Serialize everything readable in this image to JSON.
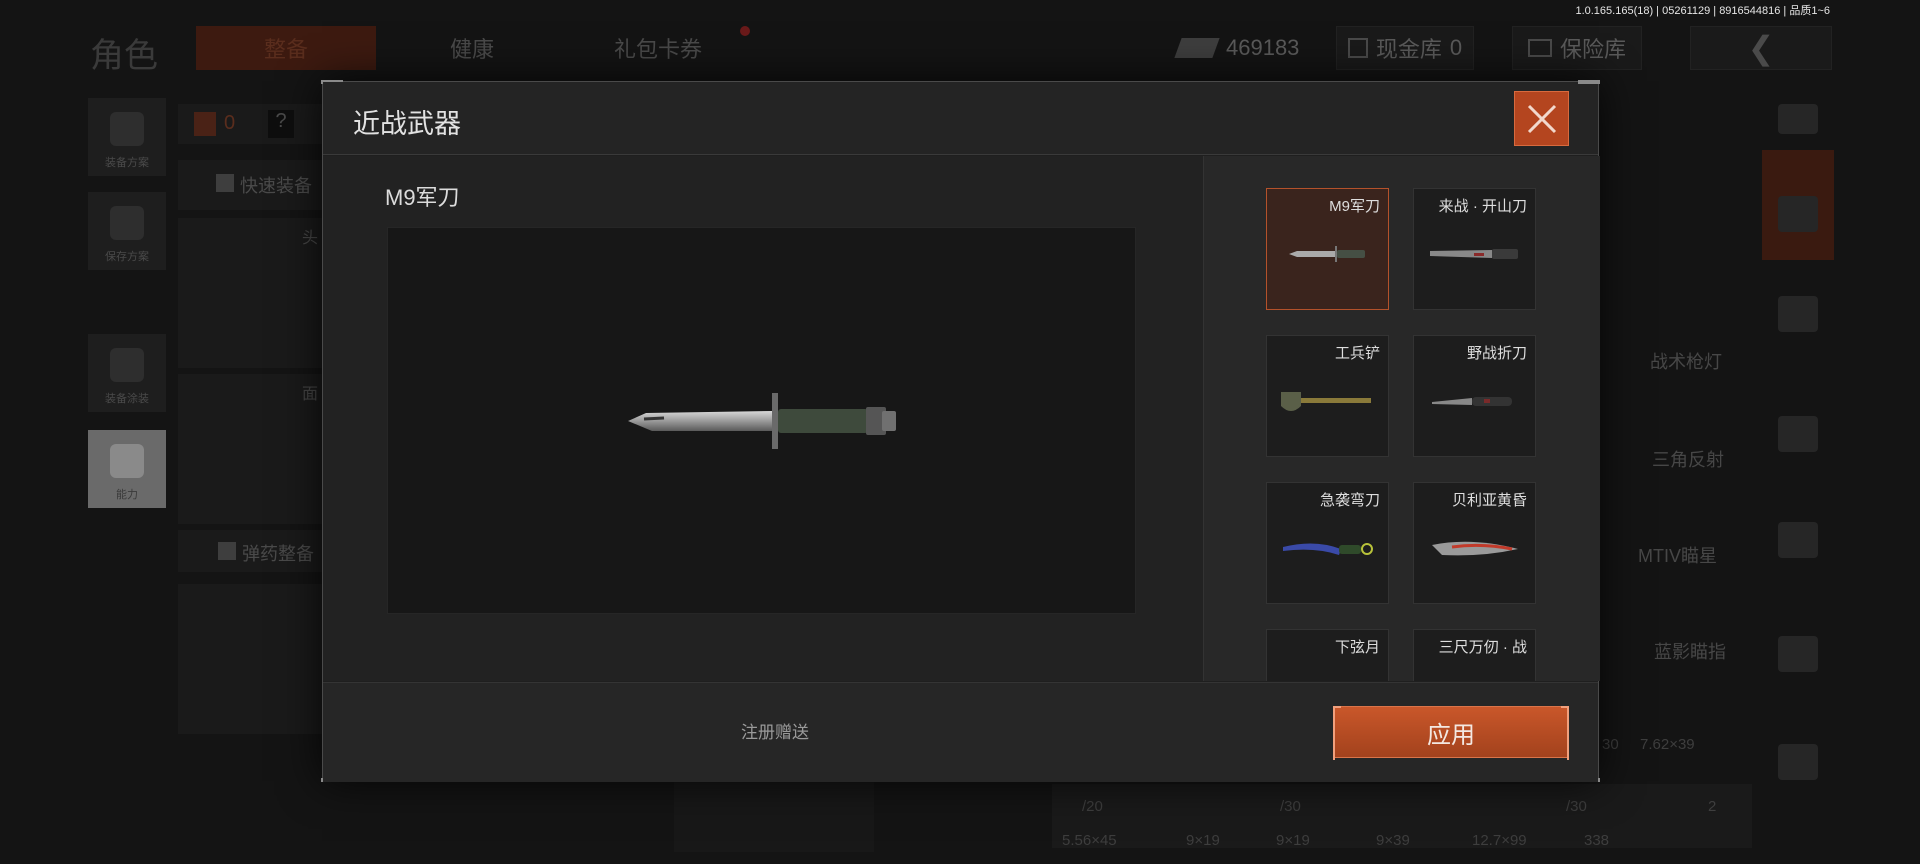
{
  "version_info": "1.0.165.165(18) | 05261129 | 8916544816 | 品质1~6",
  "background": {
    "page_title": "角色",
    "tabs": [
      {
        "label": "整备",
        "active": true
      },
      {
        "label": "健康",
        "active": false
      },
      {
        "label": "礼包卡券",
        "active": false
      }
    ],
    "currency": "469183",
    "cash_vault_label": "现金库",
    "cash_vault_count": "0",
    "insurance_label": "保险库",
    "left_buttons": [
      "装备方案",
      "保存方案",
      "装备涂装",
      "能力"
    ],
    "armor_count": "0",
    "armor_help": "?",
    "quick_equip_label": "快速装备",
    "ammo_label": "弹药整备",
    "slot_labels": [
      "头",
      "面"
    ],
    "attachments": [
      "战术枪灯",
      "三角反射",
      "MTIV瞄星",
      "蓝影瞄指"
    ],
    "ammo_cells": [
      "5.56×45",
      "9×19",
      "9×19",
      "9×39",
      "12.7×99",
      "338",
      "7.62×39"
    ],
    "ammo_counts": [
      "/20",
      "/30",
      "/30",
      "30",
      "2"
    ]
  },
  "modal": {
    "title": "近战武器",
    "selected_weapon_name": "M9军刀",
    "source_note": "注册赠送",
    "apply_label": "应用",
    "weapons": [
      {
        "name": "M9军刀",
        "selected": true,
        "icon": "bayonet-icon"
      },
      {
        "name": "来战 · 开山刀",
        "selected": false,
        "icon": "machete-icon"
      },
      {
        "name": "工兵铲",
        "selected": false,
        "icon": "shovel-icon"
      },
      {
        "name": "野战折刀",
        "selected": false,
        "icon": "folding-knife-icon"
      },
      {
        "name": "急袭弯刀",
        "selected": false,
        "icon": "karambit-icon"
      },
      {
        "name": "贝利亚黄昏",
        "selected": false,
        "icon": "curved-blade-icon"
      },
      {
        "name": "下弦月",
        "selected": false,
        "icon": "crescent-blade-icon"
      },
      {
        "name": "三尺万仞 · 战",
        "selected": false,
        "icon": "sword-icon"
      }
    ]
  },
  "colors": {
    "accent": "#b4451f",
    "selected_card": "#3a241d",
    "modal_bg": "#1f1f1f"
  }
}
